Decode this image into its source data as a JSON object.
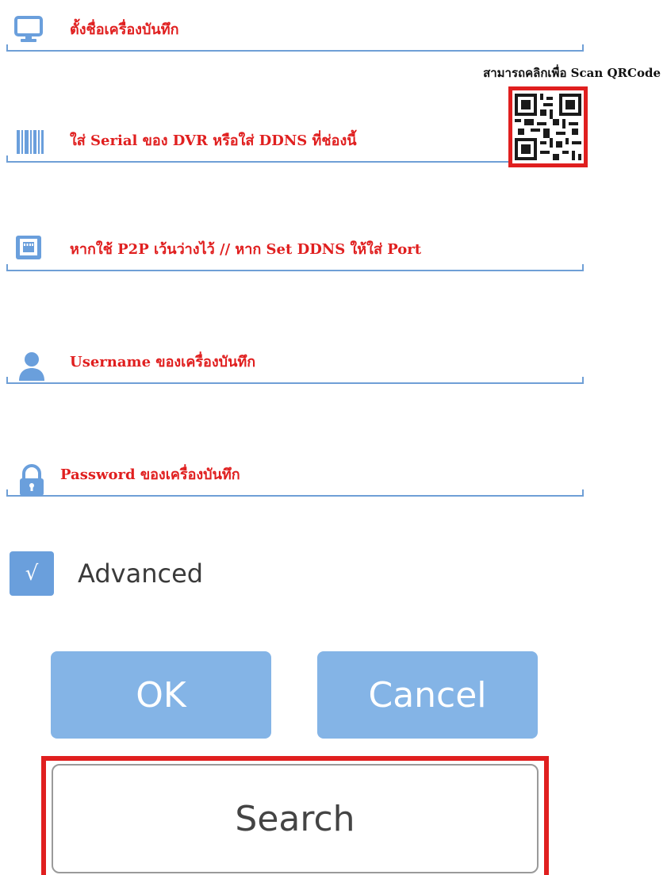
{
  "fields": [
    {
      "hint": "ตั้งชื่อเครื่องบันทึก",
      "icon": "monitor-icon"
    },
    {
      "hint": "ใส่ Serial ของ DVR หรือใส่ DDNS ที่ช่องนี้",
      "icon": "barcode-icon"
    },
    {
      "hint": "หากใช้ P2P เว้นว่างไว้ // หาก Set DDNS ให้ใส่ Port",
      "icon": "network-port-icon"
    },
    {
      "hint": "Username ของเครื่องบันทึก",
      "icon": "user-icon"
    },
    {
      "hint": "Password ของเครื่องบันทึก",
      "icon": "lock-icon"
    }
  ],
  "qr": {
    "caption": "สามารถคลิกเพื่อ Scan QRCode",
    "icon": "qr-code-icon"
  },
  "advanced": {
    "label": "Advanced",
    "checked": true,
    "check_glyph": "√"
  },
  "buttons": {
    "ok": "OK",
    "cancel": "Cancel",
    "search": "Search"
  },
  "colors": {
    "accent": "#84b4e6",
    "underline": "#6f9fd6",
    "highlight": "#e01f1f"
  }
}
